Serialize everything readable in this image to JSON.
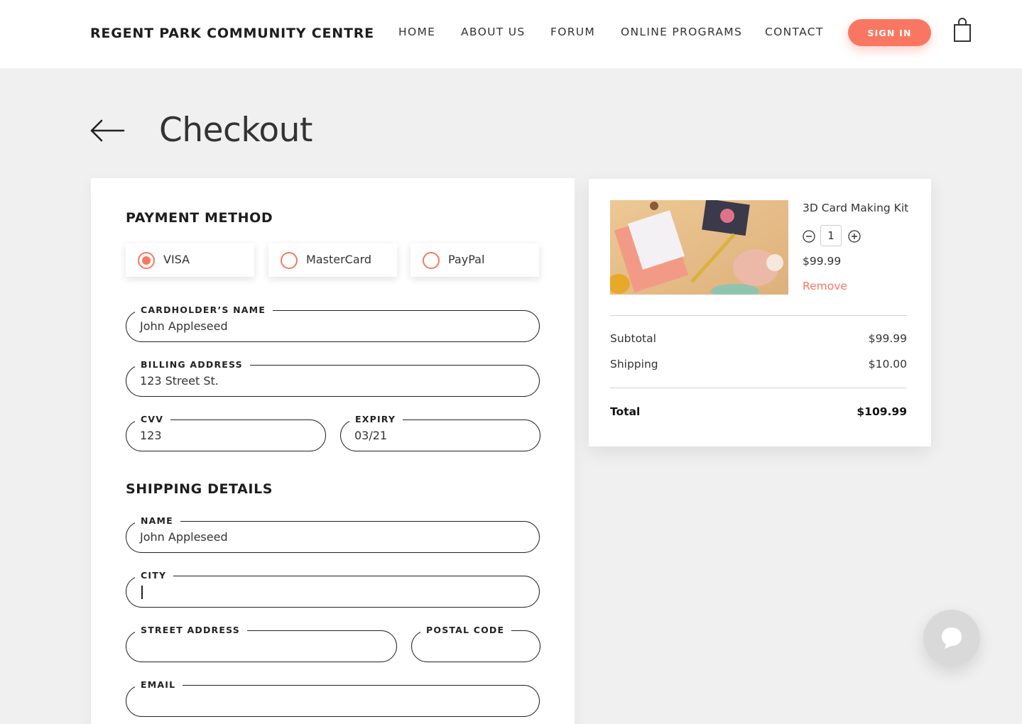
{
  "header": {
    "brand": "REGENT PARK COMMUNITY CENTRE",
    "nav": [
      "HOME",
      "ABOUT US",
      "FORUM",
      "ONLINE PROGRAMS",
      "CONTACT"
    ],
    "sign_in": "SIGN IN",
    "cart_icon": "shopping-bag-icon"
  },
  "page": {
    "title": "Checkout",
    "back_icon": "arrow-left-icon"
  },
  "payment": {
    "section_title": "PAYMENT METHOD",
    "options": [
      {
        "label": "VISA",
        "selected": true
      },
      {
        "label": "MasterCard",
        "selected": false
      },
      {
        "label": "PayPal",
        "selected": false
      }
    ],
    "cardholder": {
      "label": "CARDHOLDER’S NAME",
      "value": "John Appleseed"
    },
    "billing": {
      "label": "BILLING ADDRESS",
      "value": "123 Street St."
    },
    "cvv": {
      "label": "CVV",
      "value": "123"
    },
    "expiry": {
      "label": "EXPIRY",
      "value": "03/21"
    }
  },
  "shipping": {
    "section_title": "SHIPPING DETAILS",
    "name": {
      "label": "NAME",
      "value": "John Appleseed"
    },
    "city": {
      "label": "CITY",
      "value": ""
    },
    "street": {
      "label": "STREET ADDRESS",
      "value": ""
    },
    "postal": {
      "label": "POSTAL CODE",
      "value": ""
    },
    "email": {
      "label": "EMAIL",
      "value": ""
    }
  },
  "cart": {
    "item": {
      "name": "3D Card Making Kit",
      "quantity": "1",
      "price": "$99.99",
      "remove": "Remove"
    },
    "subtotal_label": "Subtotal",
    "subtotal": "$99.99",
    "shipping_label": "Shipping",
    "shipping": "$10.00",
    "total_label": "Total",
    "total": "$109.99"
  },
  "colors": {
    "accent": "#f97762",
    "background": "#f0f0f0"
  }
}
